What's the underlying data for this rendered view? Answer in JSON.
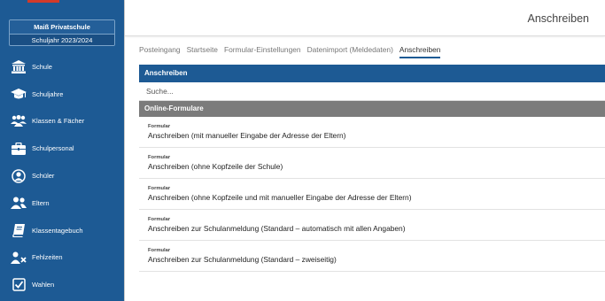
{
  "school": {
    "name": "Maiß Privatschule",
    "year": "Schuljahr 2023/2024"
  },
  "sidebar": {
    "items": [
      {
        "label": "Schule",
        "icon": "building-columns-icon"
      },
      {
        "label": "Schuljahre",
        "icon": "graduation-cap-icon"
      },
      {
        "label": "Klassen & Fächer",
        "icon": "users-group-icon"
      },
      {
        "label": "Schulpersonal",
        "icon": "briefcase-icon"
      },
      {
        "label": "Schüler",
        "icon": "user-circle-icon"
      },
      {
        "label": "Eltern",
        "icon": "two-users-icon"
      },
      {
        "label": "Klassentagebuch",
        "icon": "book-icon"
      },
      {
        "label": "Fehlzeiten",
        "icon": "user-x-icon"
      },
      {
        "label": "Wahlen",
        "icon": "checkbox-icon"
      }
    ]
  },
  "header": {
    "title": "Anschreiben"
  },
  "tabs": [
    {
      "label": "Posteingang",
      "active": false
    },
    {
      "label": "Startseite",
      "active": false
    },
    {
      "label": "Formular-Einstellungen",
      "active": false
    },
    {
      "label": "Datenimport (Meldedaten)",
      "active": false
    },
    {
      "label": "Anschreiben",
      "active": true
    }
  ],
  "main": {
    "section_title": "Anschreiben",
    "search_placeholder": "Suche...",
    "group_title": "Online-Formulare",
    "forms": [
      {
        "type": "Formular",
        "title": "Anschreiben (mit manueller Eingabe der Adresse der Eltern)"
      },
      {
        "type": "Formular",
        "title": "Anschreiben (ohne Kopfzeile der Schule)"
      },
      {
        "type": "Formular",
        "title": "Anschreiben (ohne Kopfzeile und mit manueller Eingabe der Adresse der Eltern)"
      },
      {
        "type": "Formular",
        "title": "Anschreiben zur Schulanmeldung (Standard – automatisch mit allen Angaben)"
      },
      {
        "type": "Formular",
        "title": "Anschreiben zur Schulanmeldung (Standard – zweiseitig)"
      }
    ]
  },
  "colors": {
    "sidebar": "#1d5a94",
    "primary_bar": "#1d5a94",
    "secondary_bar": "#7b7b7b",
    "accent": "#d23a2a"
  }
}
